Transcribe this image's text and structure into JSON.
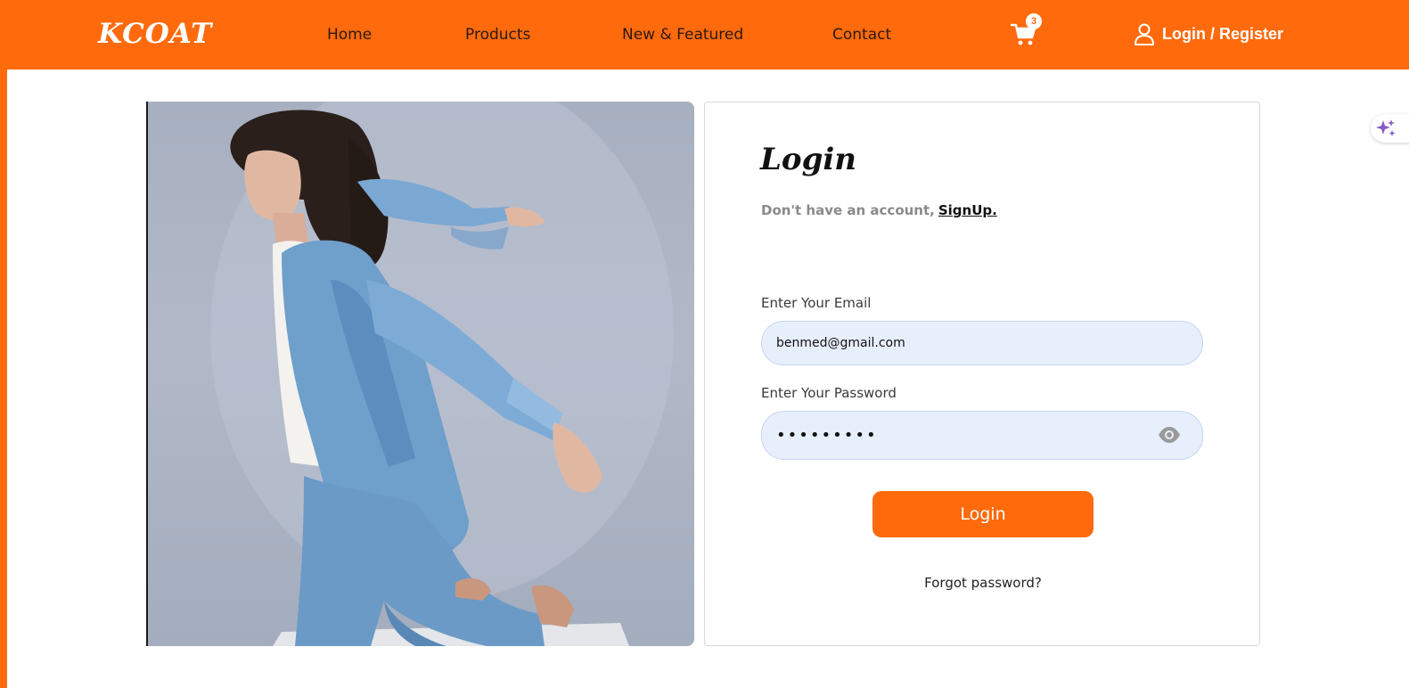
{
  "colors": {
    "accent": "#ff6a0c",
    "input_bg": "#e8effc",
    "muted_text": "#8a8a8a",
    "sparkle": "#8a5cc9"
  },
  "header": {
    "brand": "KCOAT",
    "nav": [
      {
        "label": "Home"
      },
      {
        "label": "Products"
      },
      {
        "label": "New & Featured"
      },
      {
        "label": "Contact"
      }
    ],
    "cart_icon": "cart-icon",
    "cart_count": "3",
    "user_icon": "user-icon",
    "account_label": "Login / Register"
  },
  "hero": {
    "image": "model-in-denim-jacket-photo"
  },
  "login": {
    "title": "Login",
    "no_account_text": "Don't have an account,",
    "signup_link": "SignUp.",
    "email_label": "Enter Your Email",
    "email_value": "benmed@gmail.com",
    "password_label": "Enter Your Password",
    "password_value": "•••••••••",
    "eye_icon": "eye-icon",
    "submit_label": "Login",
    "forgot_link": "Forgot password?"
  },
  "assistant": {
    "icon": "sparkle-icon"
  }
}
